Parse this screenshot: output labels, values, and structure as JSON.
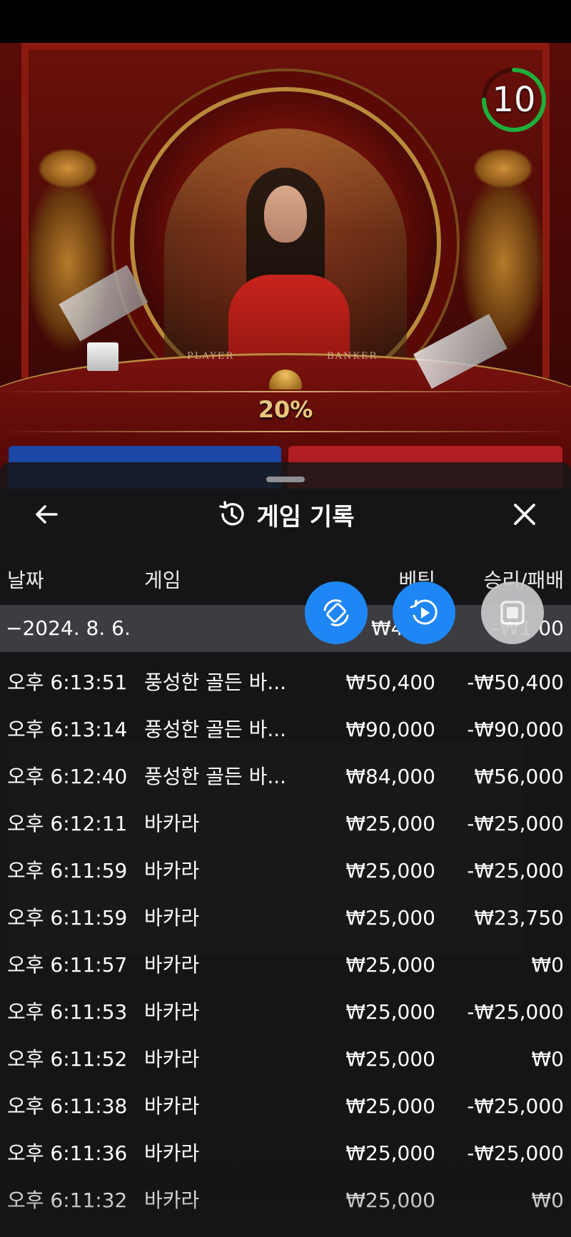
{
  "video": {
    "table_player_label": "PLAYER",
    "table_banker_label": "BANKER",
    "percent": "20%",
    "timer": "10",
    "timer_progress": 0.75
  },
  "sheet": {
    "title": "게임 기록",
    "title_icon": "history-icon",
    "back_icon": "arrow-left-icon",
    "close_icon": "close-icon",
    "columns": {
      "date": "날짜",
      "game": "게임",
      "bet": "베팅",
      "win_loss": "승리/패배"
    },
    "group": {
      "date": "−2024. 8. 6.",
      "bet": "₩479,",
      "win_loss": "-₩1    00"
    },
    "rows": [
      {
        "time": "오후 6:13:51",
        "game": "풍성한 골든 바...",
        "bet": "₩50,400",
        "result": "-₩50,400"
      },
      {
        "time": "오후 6:13:14",
        "game": "풍성한 골든 바...",
        "bet": "₩90,000",
        "result": "-₩90,000"
      },
      {
        "time": "오후 6:12:40",
        "game": "풍성한 골든 바...",
        "bet": "₩84,000",
        "result": "₩56,000"
      },
      {
        "time": "오후 6:12:11",
        "game": "바카라",
        "bet": "₩25,000",
        "result": "-₩25,000"
      },
      {
        "time": "오후 6:11:59",
        "game": "바카라",
        "bet": "₩25,000",
        "result": "-₩25,000"
      },
      {
        "time": "오후 6:11:59",
        "game": "바카라",
        "bet": "₩25,000",
        "result": "₩23,750"
      },
      {
        "time": "오후 6:11:57",
        "game": "바카라",
        "bet": "₩25,000",
        "result": "₩0"
      },
      {
        "time": "오후 6:11:53",
        "game": "바카라",
        "bet": "₩25,000",
        "result": "-₩25,000"
      },
      {
        "time": "오후 6:11:52",
        "game": "바카라",
        "bet": "₩25,000",
        "result": "₩0"
      },
      {
        "time": "오후 6:11:38",
        "game": "바카라",
        "bet": "₩25,000",
        "result": "-₩25,000"
      },
      {
        "time": "오후 6:11:36",
        "game": "바카라",
        "bet": "₩25,000",
        "result": "-₩25,000"
      },
      {
        "time": "오후 6:11:32",
        "game": "바카라",
        "bet": "₩25,000",
        "result": "₩0"
      }
    ]
  },
  "overlay_buttons": {
    "rotate_icon": "rotate-icon",
    "play_icon": "screen-record-play-icon",
    "stop_icon": "stop-icon",
    "accent": "#1f86f5"
  }
}
